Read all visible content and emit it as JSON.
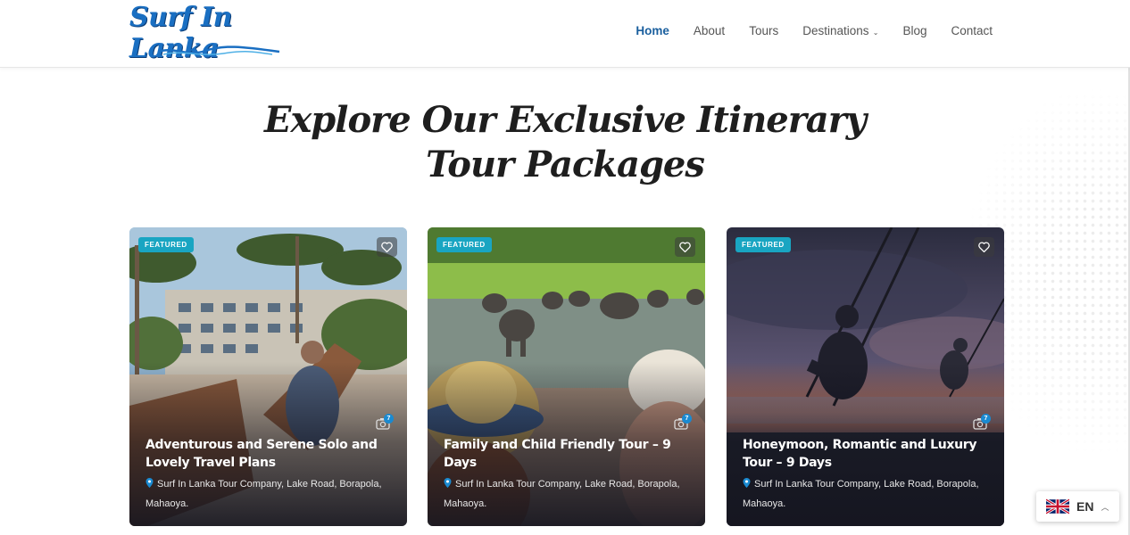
{
  "header": {
    "logo_text": "Surf In Lanka",
    "nav": [
      {
        "label": "Home",
        "active": true
      },
      {
        "label": "About",
        "active": false
      },
      {
        "label": "Tours",
        "active": false
      },
      {
        "label": "Destinations",
        "active": false,
        "has_dropdown": true
      },
      {
        "label": "Blog",
        "active": false
      },
      {
        "label": "Contact",
        "active": false
      }
    ]
  },
  "section": {
    "title_line1": "Explore Our Exclusive Itinerary",
    "title_line2": "Tour Packages"
  },
  "cards": [
    {
      "badge": "FEATURED",
      "title": "Adventurous and Serene Solo and Lovely Travel Plans",
      "location": "Surf In Lanka Tour Company, Lake Road, Borapola, Mahaoya.",
      "photo_count": "7",
      "icon": "heart-icon"
    },
    {
      "badge": "FEATURED",
      "title": "Family and Child Friendly Tour – 9 Days",
      "location": "Surf In Lanka Tour Company, Lake Road, Borapola, Mahaoya.",
      "photo_count": "7",
      "icon": "heart-icon"
    },
    {
      "badge": "FEATURED",
      "title": "Honeymoon, Romantic and Luxury Tour – 9 Days",
      "location": "Surf In Lanka Tour Company, Lake Road, Borapola, Mahaoya.",
      "photo_count": "7",
      "icon": "heart-icon"
    }
  ],
  "language": {
    "code": "EN",
    "flag": "uk-flag-icon"
  },
  "colors": {
    "brand": "#1a6fc2",
    "badge": "#19a5c2",
    "nav_active": "#1a5f9e"
  }
}
